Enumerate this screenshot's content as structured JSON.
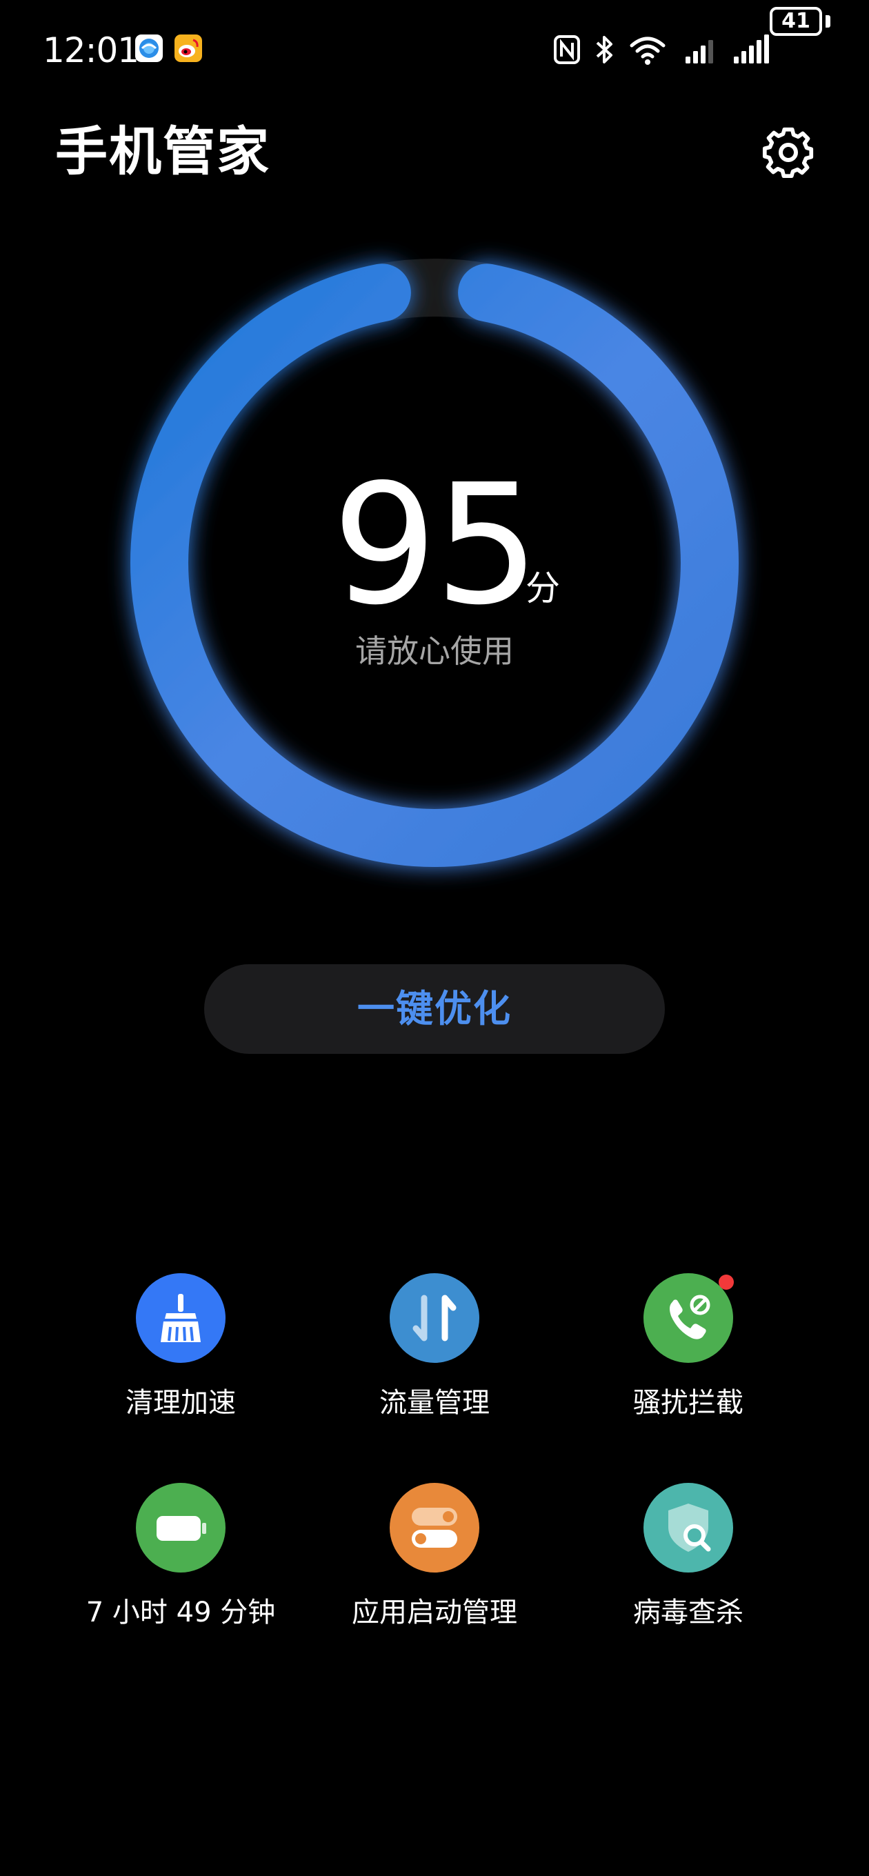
{
  "status_bar": {
    "time": "12:01",
    "battery_level": "41",
    "notification_icons": [
      "browser-icon",
      "weibo-icon"
    ],
    "system_icons": [
      "nfc-icon",
      "bluetooth-icon",
      "wifi-icon",
      "signal-icon",
      "signal-icon"
    ]
  },
  "header": {
    "title": "手机管家",
    "settings_icon": "gear-icon"
  },
  "score": {
    "value": "95",
    "unit": "分",
    "status": "请放心使用",
    "fraction": 0.95
  },
  "optimize_button": {
    "label": "一键优化"
  },
  "tools": [
    {
      "label": "清理加速",
      "icon": "broom-icon",
      "color": "#3478f6"
    },
    {
      "label": "流量管理",
      "icon": "data-arrows-icon",
      "color": "#3d8ed0"
    },
    {
      "label": "骚扰拦截",
      "icon": "phone-block-icon",
      "color": "#4caf50",
      "has_badge": true
    },
    {
      "label": "7 小时 49 分钟",
      "icon": "battery-icon",
      "color": "#4caf50"
    },
    {
      "label": "应用启动管理",
      "icon": "toggle-switches-icon",
      "color": "#e8893a"
    },
    {
      "label": "病毒查杀",
      "icon": "shield-search-icon",
      "color": "#4db6ac"
    }
  ],
  "colors": {
    "accent": "#4d8fef",
    "ring": "#3f7ee0",
    "background": "#000000"
  }
}
